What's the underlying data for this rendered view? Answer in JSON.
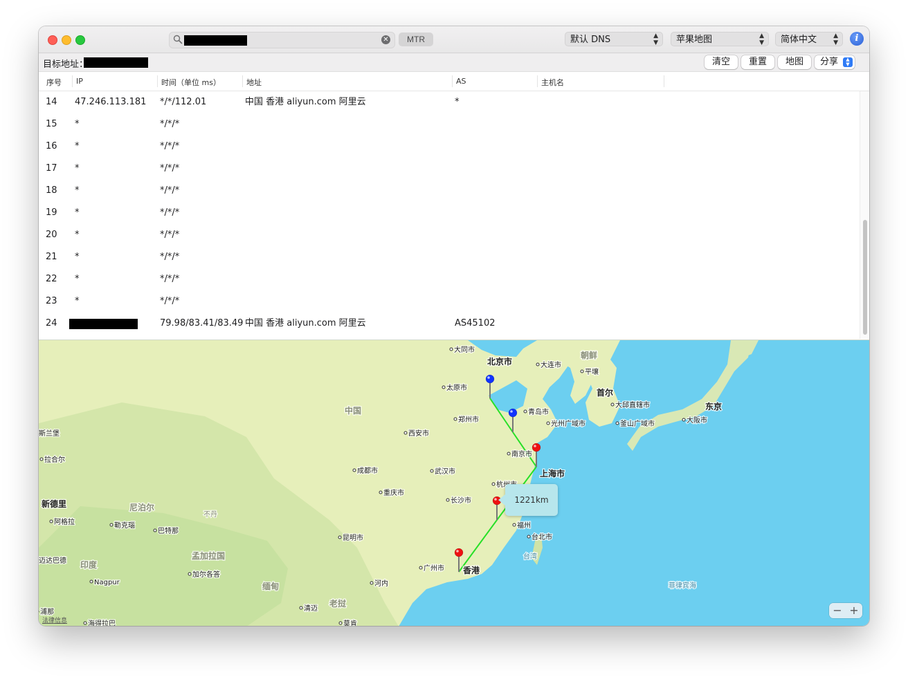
{
  "toolbar": {
    "mtr_label": "MTR",
    "dns_select": "默认 DNS",
    "map_select": "苹果地图",
    "lang_select": "简体中文"
  },
  "target": {
    "label": "目标地址："
  },
  "actions": {
    "clear": "清空",
    "reset": "重置",
    "map": "地图",
    "share": "分享"
  },
  "table": {
    "columns": [
      "序号",
      "IP",
      "时间（单位 ms）",
      "地址",
      "AS",
      "主机名"
    ],
    "rows": [
      {
        "seq": "14",
        "ip": "47.246.113.181",
        "time": "*/*/112.01",
        "address": "中国 香港 aliyun.com 阿里云",
        "as": "*",
        "host": ""
      },
      {
        "seq": "15",
        "ip": "*",
        "time": "*/*/*",
        "address": "",
        "as": "",
        "host": ""
      },
      {
        "seq": "16",
        "ip": "*",
        "time": "*/*/*",
        "address": "",
        "as": "",
        "host": ""
      },
      {
        "seq": "17",
        "ip": "*",
        "time": "*/*/*",
        "address": "",
        "as": "",
        "host": ""
      },
      {
        "seq": "18",
        "ip": "*",
        "time": "*/*/*",
        "address": "",
        "as": "",
        "host": ""
      },
      {
        "seq": "19",
        "ip": "*",
        "time": "*/*/*",
        "address": "",
        "as": "",
        "host": ""
      },
      {
        "seq": "20",
        "ip": "*",
        "time": "*/*/*",
        "address": "",
        "as": "",
        "host": ""
      },
      {
        "seq": "21",
        "ip": "*",
        "time": "*/*/*",
        "address": "",
        "as": "",
        "host": ""
      },
      {
        "seq": "22",
        "ip": "*",
        "time": "*/*/*",
        "address": "",
        "as": "",
        "host": ""
      },
      {
        "seq": "23",
        "ip": "*",
        "time": "*/*/*",
        "address": "",
        "as": "",
        "host": ""
      },
      {
        "seq": "24",
        "ip": "",
        "time": "79.98/83.41/83.49",
        "address": "中国 香港 aliyun.com 阿里云",
        "as": "AS45102",
        "host": ""
      }
    ]
  },
  "map": {
    "distance_label": "1221km",
    "legal_label": "法律信息",
    "zoom_out": "−",
    "zoom_in": "+",
    "colors": {
      "sea": "#6ccff0",
      "land": "#e7efb9",
      "route": "#27e027",
      "pin_blue": "#1133ff",
      "pin_red": "#ee1111"
    },
    "labels": [
      {
        "text": "大同市",
        "bold": false
      },
      {
        "text": "北京市",
        "bold": true
      },
      {
        "text": "大连市",
        "bold": false
      },
      {
        "text": "朝鲜",
        "bold": true
      },
      {
        "text": "平壤",
        "bold": false
      },
      {
        "text": "太原市",
        "bold": false
      },
      {
        "text": "首尔",
        "bold": true
      },
      {
        "text": "中国",
        "bold": true
      },
      {
        "text": "青岛市",
        "bold": false
      },
      {
        "text": "大邱直辖市",
        "bold": false
      },
      {
        "text": "东京",
        "bold": true
      },
      {
        "text": "郑州市",
        "bold": false
      },
      {
        "text": "光州广域市",
        "bold": false
      },
      {
        "text": "釜山广域市",
        "bold": false
      },
      {
        "text": "大阪市",
        "bold": false
      },
      {
        "text": "斯兰堡",
        "bold": false
      },
      {
        "text": "西安市",
        "bold": false
      },
      {
        "text": "南京市",
        "bold": false
      },
      {
        "text": "拉合尔",
        "bold": false
      },
      {
        "text": "成都市",
        "bold": false
      },
      {
        "text": "武汉市",
        "bold": false
      },
      {
        "text": "上海市",
        "bold": true
      },
      {
        "text": "杭州市",
        "bold": false
      },
      {
        "text": "重庆市",
        "bold": false
      },
      {
        "text": "长沙市",
        "bold": false
      },
      {
        "text": "新德里",
        "bold": true
      },
      {
        "text": "尼泊尔",
        "bold": true
      },
      {
        "text": "不丹",
        "bold": false
      },
      {
        "text": "阿格拉",
        "bold": false
      },
      {
        "text": "勒克瑙",
        "bold": false
      },
      {
        "text": "巴特那",
        "bold": false
      },
      {
        "text": "福州",
        "bold": false
      },
      {
        "text": "台北市",
        "bold": false
      },
      {
        "text": "昆明市",
        "bold": false
      },
      {
        "text": "台湾",
        "bold": false
      },
      {
        "text": "印度",
        "bold": true
      },
      {
        "text": "孟加拉国",
        "bold": true
      },
      {
        "text": "迈达巴德",
        "bold": false
      },
      {
        "text": "加尔各答",
        "bold": false
      },
      {
        "text": "广州市",
        "bold": false
      },
      {
        "text": "香港",
        "bold": true
      },
      {
        "text": "Nagpur",
        "bold": false
      },
      {
        "text": "缅甸",
        "bold": true
      },
      {
        "text": "河内",
        "bold": false
      },
      {
        "text": "菲律宾海",
        "bold": false
      },
      {
        "text": "清迈",
        "bold": false
      },
      {
        "text": "老挝",
        "bold": true
      },
      {
        "text": "浦那",
        "bold": false
      },
      {
        "text": "海得拉巴",
        "bold": false
      },
      {
        "text": "莫肯",
        "bold": false
      }
    ]
  }
}
